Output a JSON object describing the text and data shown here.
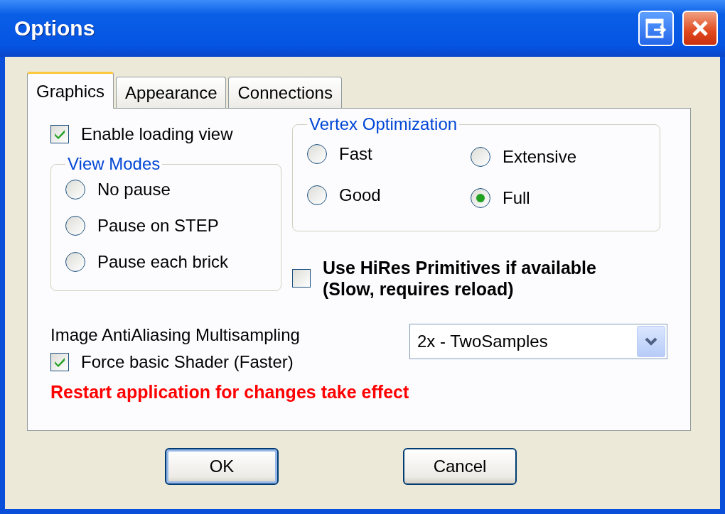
{
  "window": {
    "title": "Options"
  },
  "tabs": [
    {
      "label": "Graphics",
      "selected": true
    },
    {
      "label": "Appearance",
      "selected": false
    },
    {
      "label": "Connections",
      "selected": false
    }
  ],
  "enable_loading_view": {
    "label": "Enable loading view",
    "checked": true
  },
  "view_modes": {
    "title": "View Modes",
    "options": [
      {
        "label": "No pause",
        "selected": false
      },
      {
        "label": "Pause on STEP",
        "selected": false
      },
      {
        "label": "Pause each brick",
        "selected": false
      }
    ]
  },
  "vertex_optimization": {
    "title": "Vertex Optimization",
    "options": [
      {
        "label": "Fast",
        "selected": false
      },
      {
        "label": "Extensive",
        "selected": false
      },
      {
        "label": "Good",
        "selected": false
      },
      {
        "label": "Full",
        "selected": true
      }
    ]
  },
  "hires_primitives": {
    "label": "Use HiRes Primitives if available (Slow, requires reload)",
    "checked": false
  },
  "antialiasing": {
    "label": "Image AntiAliasing Multisampling",
    "value": "2x - TwoSamples"
  },
  "force_basic_shader": {
    "label": "Force basic Shader (Faster)",
    "checked": true
  },
  "warning": "Restart application for changes take effect",
  "buttons": [
    "OK",
    "Cancel"
  ]
}
